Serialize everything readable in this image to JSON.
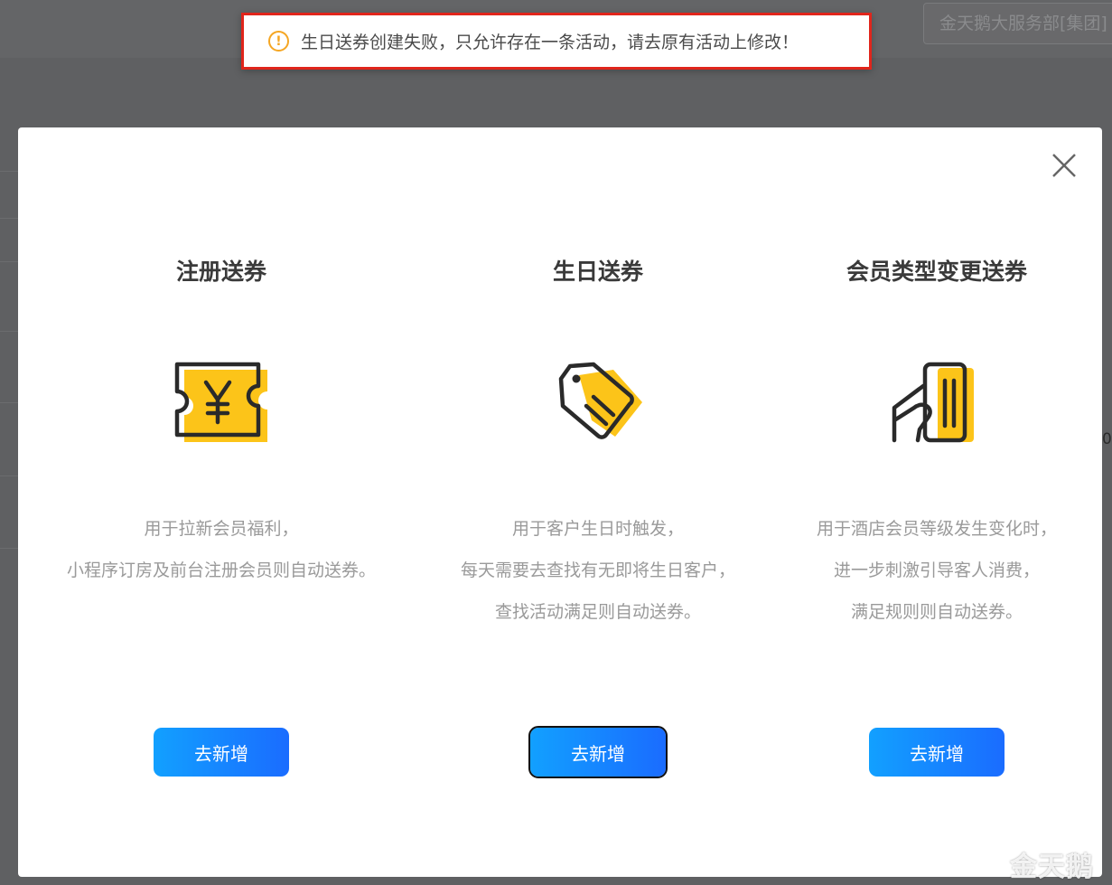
{
  "background": {
    "org_selector": "金天鹅大服务部[集团]",
    "edge_text": "0."
  },
  "toast": {
    "icon": "warning-icon",
    "message": "生日送券创建失败，只允许存在一条活动，请去原有活动上修改！"
  },
  "modal": {
    "close_icon": "close-icon",
    "cards": [
      {
        "title": "注册送券",
        "icon": "yen-coupon-icon",
        "desc": [
          "用于拉新会员福利，",
          "小程序订房及前台注册会员则自动送券。"
        ],
        "button": "去新增"
      },
      {
        "title": "生日送券",
        "icon": "tag-icon",
        "desc": [
          "用于客户生日时触发，",
          "每天需要去查找有无即将生日客户，",
          "查找活动满足则自动送券。"
        ],
        "button": "去新增"
      },
      {
        "title": "会员类型变更送券",
        "icon": "card-in-hand-icon",
        "desc": [
          "用于酒店会员等级发生变化时，",
          "进一步刺激引导客人消费，",
          "满足规则则自动送券。"
        ],
        "button": "去新增"
      }
    ]
  },
  "watermark": "金天鹅",
  "colors": {
    "accent_yellow": "#fcc419",
    "button_gradient_start": "#12a0ff",
    "button_gradient_end": "#1a6cff",
    "toast_border": "#e0251b",
    "warning": "#f5a623"
  }
}
